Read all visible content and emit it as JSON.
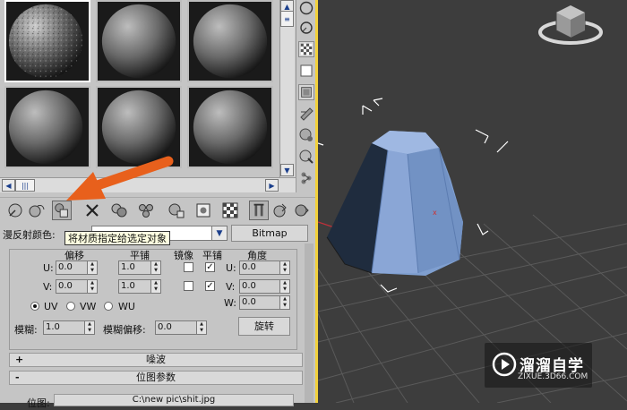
{
  "material_editor": {
    "toolbar_buttons": [
      {
        "icon": "get-material-icon"
      },
      {
        "icon": "put-to-scene-icon"
      },
      {
        "icon": "assign-material-icon",
        "tooltip": "将材质指定给选定对象"
      },
      {
        "icon": "reset-map-icon"
      },
      {
        "icon": "make-copy-icon"
      },
      {
        "icon": "make-unique-icon"
      },
      {
        "icon": "put-to-library-icon"
      },
      {
        "icon": "material-id-icon"
      },
      {
        "icon": "show-map-icon"
      },
      {
        "icon": "show-end-result-icon"
      },
      {
        "icon": "go-to-parent-icon"
      },
      {
        "icon": "go-forward-sibling-icon"
      }
    ],
    "side_buttons": [
      "sample-type-icon",
      "backlight-icon",
      "background-icon",
      "uv-tiling-icon",
      "video-color-check-icon",
      "make-preview-icon",
      "options-icon",
      "select-by-material-icon",
      "material-navigator-icon"
    ],
    "diffuse_color_label": "漫反射颜色:",
    "map_button_label": "Bitmap",
    "tooltip": "将材质指定给选定对象"
  },
  "coordinates": {
    "col_offset": "偏移",
    "col_tiling": "平铺",
    "col_mirror": "镜像",
    "col_tile": "平铺",
    "col_angle": "角度",
    "u_label": "U:",
    "v_label": "V:",
    "w_label": "W:",
    "u_offset": "0.0",
    "v_offset": "0.0",
    "u_tiling": "1.0",
    "v_tiling": "1.0",
    "u_angle": "0.0",
    "v_angle": "0.0",
    "w_angle": "0.0",
    "u_mirror": false,
    "v_mirror": false,
    "u_tile": true,
    "v_tile": true,
    "radio_uv": "UV",
    "radio_vw": "VW",
    "radio_wu": "WU",
    "radio_selected": "UV",
    "blur_label": "模糊:",
    "blur_value": "1.0",
    "blur_offset_label": "模糊偏移:",
    "blur_offset_value": "0.0",
    "rotate_label": "旋转"
  },
  "rollouts": [
    {
      "sign": "+",
      "title": "噪波"
    },
    {
      "sign": "-",
      "title": "位图参数"
    }
  ],
  "bitmap_params": {
    "bitmap_label": "位图:",
    "bitmap_path": "C:\\new pic\\shit.jpg"
  },
  "watermark": {
    "title": "溜溜自学",
    "url": "ZIXUE.3D66.COM"
  },
  "colors": {
    "panel": "#c5c5c5",
    "viewport_bg": "#3d3d3d",
    "object_face": "#7f9fd0",
    "highlight_arrow": "#e8601c",
    "viewport_border": "#f2d13b"
  }
}
